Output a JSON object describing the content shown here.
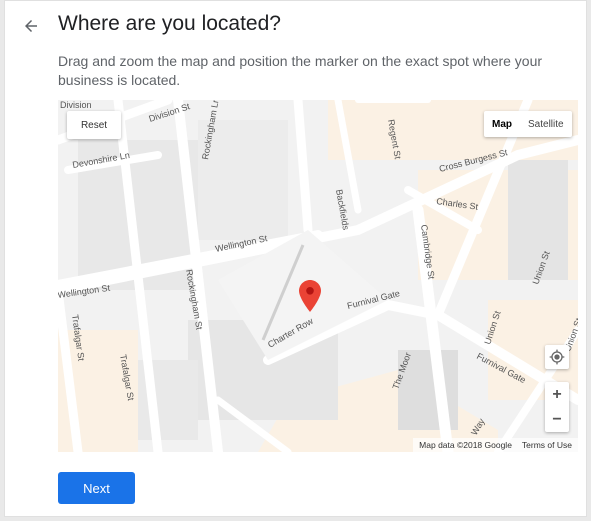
{
  "page": {
    "title": "Where are you located?",
    "description": "Drag and zoom the map and position the marker on the exact spot where your business is located."
  },
  "icons": {
    "back": "arrow-left-icon",
    "locate": "my-location-icon",
    "marker": "map-pin-icon"
  },
  "map": {
    "reset_label": "Reset",
    "type_map_label": "Map",
    "type_satellite_label": "Satellite",
    "zoom_in_label": "+",
    "zoom_out_label": "−",
    "attribution": "Map data ©2018 Google",
    "terms_label": "Terms of Use",
    "marker_color": "#ea4335",
    "streets": {
      "division": "Division St",
      "division_edge": "Division",
      "devonshire": "Devonshire Ln",
      "rockingham_ln": "Rockingham Ln",
      "backfields": "Backfields",
      "regent": "Regent St",
      "cross_burgess": "Cross Burgess St",
      "charles": "Charles St",
      "cambridge": "Cambridge St",
      "union": "Union St",
      "wellington": "Wellington St",
      "wellington_edge": "Wellington St",
      "trafalgar_left": "Trafalgar St",
      "trafalgar": "Trafalgar St",
      "rockingham_st": "Rockingham St",
      "charter_row": "Charter Row",
      "furnival_gate": "Furnival Gate",
      "furnival_gate_2": "Furnival Gate",
      "the_moor": "The Moor",
      "union_2": "Union St",
      "union_3": "Union St",
      "way": "Way"
    }
  },
  "actions": {
    "next_label": "Next"
  },
  "colors": {
    "primary": "#1a73e8",
    "title": "#202124",
    "text_secondary": "#5f6368"
  }
}
